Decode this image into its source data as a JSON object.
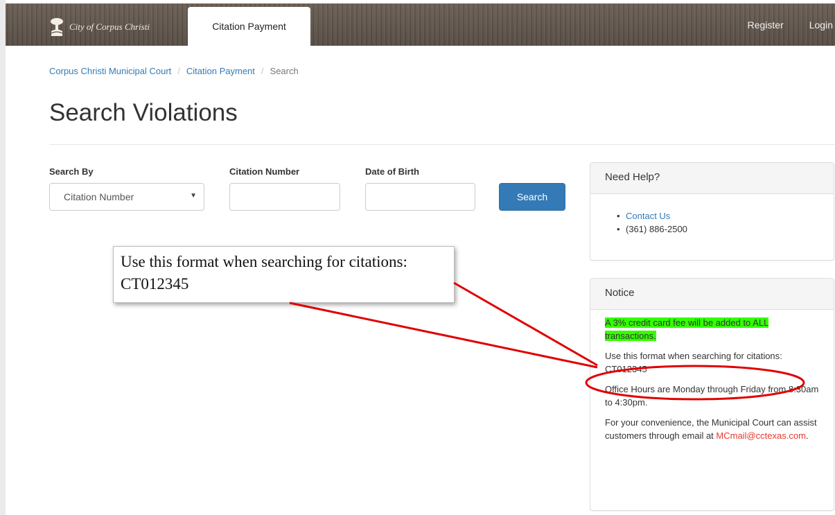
{
  "nav": {
    "brand_text": "City of Corpus Christi",
    "active_tab": "Citation Payment",
    "register_label": "Register",
    "login_label": "Login"
  },
  "breadcrumb": {
    "items": [
      "Corpus Christi Municipal Court",
      "Citation Payment",
      "Search"
    ],
    "separator": "/"
  },
  "page": {
    "title": "Search Violations"
  },
  "search_form": {
    "search_by_label": "Search By",
    "search_by_value": "Citation Number",
    "citation_number_label": "Citation Number",
    "citation_number_value": "",
    "dob_label": "Date of Birth",
    "dob_value": "",
    "search_button": "Search"
  },
  "help_panel": {
    "title": "Need Help?",
    "contact_link": "Contact Us",
    "phone": "(361) 886-2500"
  },
  "notice_panel": {
    "title": "Notice",
    "fee_notice": "A 3% credit card fee will be added to ALL transactions.",
    "format_notice": "Use this format when searching for citations:  CT012345",
    "office_hours": "Office Hours are Monday through Friday from 8:30am to 4:30pm.",
    "convenience_prefix": "For your convenience, the Municipal Court can assist customers through email at ",
    "email": "MCmail@cctexas.com",
    "convenience_suffix": "."
  },
  "annotation": {
    "callout_text": "Use this format when searching for citations: CT012345"
  },
  "colors": {
    "link": "#337ab7",
    "button": "#337ab7",
    "highlight": "#33ff00",
    "annotation": "#e00000",
    "email_link": "#e8392b"
  }
}
